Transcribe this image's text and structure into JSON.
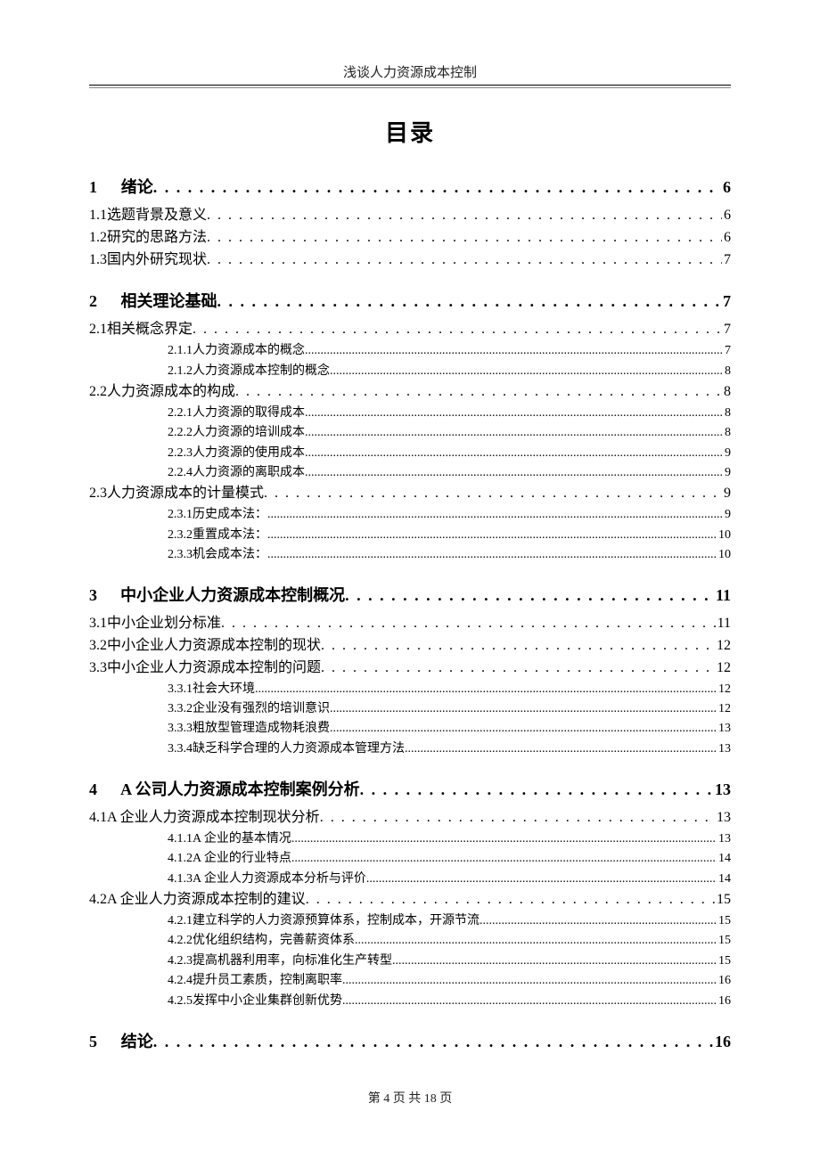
{
  "header": {
    "running_title": "浅谈人力资源成本控制"
  },
  "title": "目录",
  "toc": [
    {
      "level": 1,
      "num": "1",
      "label": "绪论",
      "page": "6"
    },
    {
      "level": 2,
      "num": "1.1",
      "label": " 选题背景及意义",
      "page": "6"
    },
    {
      "level": 2,
      "num": "1.2",
      "label": " 研究的思路方法",
      "page": "6"
    },
    {
      "level": 2,
      "num": "1.3",
      "label": "国内外研究现状",
      "page": "7"
    },
    {
      "level": 1,
      "num": "2",
      "label": "相关理论基础",
      "page": "7"
    },
    {
      "level": 2,
      "num": "2.1",
      "label": " 相关概念界定",
      "page": "7"
    },
    {
      "level": 3,
      "num": "2.1.1",
      "label": " 人力资源成本的概念",
      "page": "7"
    },
    {
      "level": 3,
      "num": "2.1.2",
      "label": " 人力资源成本控制的概念",
      "page": "8"
    },
    {
      "level": 2,
      "num": "2.2",
      "label": " 人力资源成本的构成",
      "page": "8"
    },
    {
      "level": 3,
      "num": "2.2.1",
      "label": " 人力资源的取得成本",
      "page": "8"
    },
    {
      "level": 3,
      "num": "2.2.2",
      "label": " 人力资源的培训成本",
      "page": "8"
    },
    {
      "level": 3,
      "num": "2.2.3",
      "label": " 人力资源的使用成本",
      "page": "9"
    },
    {
      "level": 3,
      "num": "2.2.4",
      "label": " 人力资源的离职成本",
      "page": "9"
    },
    {
      "level": 2,
      "num": "2.3",
      "label": " 人力资源成本的计量模式",
      "page": "9"
    },
    {
      "level": 3,
      "num": "2.3.1",
      "label": " 历史成本法：",
      "page": "9"
    },
    {
      "level": 3,
      "num": "2.3.2",
      "label": " 重置成本法：",
      "page": "10"
    },
    {
      "level": 3,
      "num": "2.3.3",
      "label": " 机会成本法：",
      "page": "10"
    },
    {
      "level": 1,
      "num": "3",
      "label": "中小企业人力资源成本控制概况",
      "page": "11"
    },
    {
      "level": 2,
      "num": "3.1",
      "label": " 中小企业划分标准",
      "page": "11"
    },
    {
      "level": 2,
      "num": "3.2",
      "label": "中小企业人力资源成本控制的现状",
      "page": "12"
    },
    {
      "level": 2,
      "num": "3.3",
      "label": "中小企业人力资源成本控制的问题",
      "page": "12"
    },
    {
      "level": 3,
      "num": "3.3.1",
      "label": " 社会大环境",
      "page": "12"
    },
    {
      "level": 3,
      "num": "3.3.2",
      "label": " 企业没有强烈的培训意识",
      "page": "12"
    },
    {
      "level": 3,
      "num": "3.3.3",
      "label": " 粗放型管理造成物耗浪费",
      "page": "13"
    },
    {
      "level": 3,
      "num": "3.3.4",
      "label": " 缺乏科学合理的人力资源成本管理方法",
      "page": "13"
    },
    {
      "level": 1,
      "num": "4",
      "label": "A 公司人力资源成本控制案例分析",
      "page": "13"
    },
    {
      "level": 2,
      "num": "4.1",
      "label": " A 企业人力资源成本控制现状分析",
      "page": "13"
    },
    {
      "level": 3,
      "num": "4.1.1",
      "label": " A 企业的基本情况",
      "page": "13"
    },
    {
      "level": 3,
      "num": "4.1.2",
      "label": " A 企业的行业特点",
      "page": "14"
    },
    {
      "level": 3,
      "num": "4.1.3",
      "label": " A 企业人力资源成本分析与评价",
      "page": "14"
    },
    {
      "level": 2,
      "num": "4.2",
      "label": " A 企业人力资源成本控制的建议",
      "page": "15"
    },
    {
      "level": 3,
      "num": "4.2.1",
      "label": " 建立科学的人力资源预算体系，控制成本，开源节流",
      "page": "15"
    },
    {
      "level": 3,
      "num": "4.2.2",
      "label": " 优化组织结构，完善薪资体系",
      "page": "15"
    },
    {
      "level": 3,
      "num": "4.2.3",
      "label": " 提高机器利用率，向标准化生产转型",
      "page": "15"
    },
    {
      "level": 3,
      "num": "4.2.4",
      "label": " 提升员工素质，控制离职率",
      "page": "16"
    },
    {
      "level": 3,
      "num": "4.2.5",
      "label": " 发挥中小企业集群创新优势",
      "page": "16"
    },
    {
      "level": 1,
      "num": "5",
      "label": "结论",
      "page": "16"
    }
  ],
  "footer": {
    "text": "第 4 页 共 18 页"
  }
}
